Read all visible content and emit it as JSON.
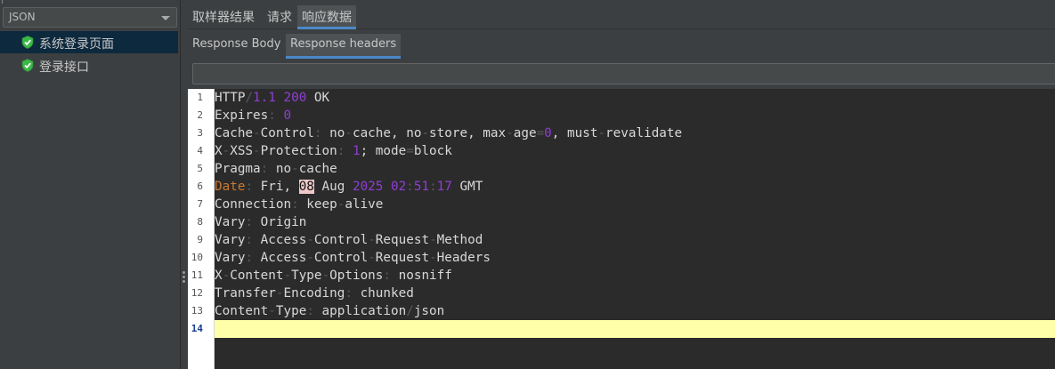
{
  "sidebar": {
    "combo_value": "JSON",
    "items": [
      {
        "label": "系统登录页面",
        "selected": true
      },
      {
        "label": "登录接口",
        "selected": false
      }
    ]
  },
  "tabs": [
    "取样器结果",
    "请求",
    "响应数据"
  ],
  "active_tab": "响应数据",
  "subtabs": [
    "Response Body",
    "Response headers"
  ],
  "active_subtab": "Response headers",
  "search": {
    "value": ""
  },
  "editor": {
    "current_line": 14,
    "lines": [
      {
        "n": "1",
        "segs": [
          [
            "k",
            "HTTP"
          ],
          [
            "p",
            "/"
          ],
          [
            "n",
            "1.1"
          ],
          [
            "p",
            " "
          ],
          [
            "n",
            "200"
          ],
          [
            "p",
            " "
          ],
          [
            "k",
            "OK"
          ]
        ]
      },
      {
        "n": "2",
        "segs": [
          [
            "k",
            "Expires"
          ],
          [
            "p",
            ": "
          ],
          [
            "n",
            "0"
          ]
        ]
      },
      {
        "n": "3",
        "segs": [
          [
            "k",
            "Cache"
          ],
          [
            "p",
            "-"
          ],
          [
            "k",
            "Control"
          ],
          [
            "p",
            ": "
          ],
          [
            "k",
            "no"
          ],
          [
            "p",
            "-"
          ],
          [
            "k",
            "cache, no"
          ],
          [
            "p",
            "-"
          ],
          [
            "k",
            "store, max"
          ],
          [
            "p",
            "-"
          ],
          [
            "k",
            "age"
          ],
          [
            "p",
            "="
          ],
          [
            "n",
            "0"
          ],
          [
            "k",
            ", must"
          ],
          [
            "p",
            "-"
          ],
          [
            "k",
            "revalidate"
          ]
        ]
      },
      {
        "n": "4",
        "segs": [
          [
            "k",
            "X"
          ],
          [
            "p",
            "-"
          ],
          [
            "k",
            "XSS"
          ],
          [
            "p",
            "-"
          ],
          [
            "k",
            "Protection"
          ],
          [
            "p",
            ": "
          ],
          [
            "n",
            "1"
          ],
          [
            "k",
            "; mode"
          ],
          [
            "p",
            "="
          ],
          [
            "k",
            "block"
          ]
        ]
      },
      {
        "n": "5",
        "segs": [
          [
            "k",
            "Pragma"
          ],
          [
            "p",
            ": "
          ],
          [
            "k",
            "no"
          ],
          [
            "p",
            "-"
          ],
          [
            "k",
            "cache"
          ]
        ]
      },
      {
        "n": "6",
        "segs": [
          [
            "o",
            "Date"
          ],
          [
            "p",
            ": "
          ],
          [
            "k",
            "Fri, "
          ],
          [
            "h",
            "08"
          ],
          [
            "p",
            " "
          ],
          [
            "k",
            "Aug"
          ],
          [
            "p",
            " "
          ],
          [
            "n",
            "2025"
          ],
          [
            "p",
            " "
          ],
          [
            "n",
            "02"
          ],
          [
            "p",
            ":"
          ],
          [
            "n",
            "51"
          ],
          [
            "p",
            ":"
          ],
          [
            "n",
            "17"
          ],
          [
            "p",
            " "
          ],
          [
            "k",
            "GMT"
          ]
        ]
      },
      {
        "n": "7",
        "segs": [
          [
            "k",
            "Connection"
          ],
          [
            "p",
            ": "
          ],
          [
            "k",
            "keep"
          ],
          [
            "p",
            "-"
          ],
          [
            "k",
            "alive"
          ]
        ]
      },
      {
        "n": "8",
        "segs": [
          [
            "k",
            "Vary"
          ],
          [
            "p",
            ": "
          ],
          [
            "k",
            "Origin"
          ]
        ]
      },
      {
        "n": "9",
        "segs": [
          [
            "k",
            "Vary"
          ],
          [
            "p",
            ": "
          ],
          [
            "k",
            "Access"
          ],
          [
            "p",
            "-"
          ],
          [
            "k",
            "Control"
          ],
          [
            "p",
            "-"
          ],
          [
            "k",
            "Request"
          ],
          [
            "p",
            "-"
          ],
          [
            "k",
            "Method"
          ]
        ]
      },
      {
        "n": "10",
        "segs": [
          [
            "k",
            "Vary"
          ],
          [
            "p",
            ": "
          ],
          [
            "k",
            "Access"
          ],
          [
            "p",
            "-"
          ],
          [
            "k",
            "Control"
          ],
          [
            "p",
            "-"
          ],
          [
            "k",
            "Request"
          ],
          [
            "p",
            "-"
          ],
          [
            "k",
            "Headers"
          ]
        ]
      },
      {
        "n": "11",
        "segs": [
          [
            "k",
            "X"
          ],
          [
            "p",
            "-"
          ],
          [
            "k",
            "Content"
          ],
          [
            "p",
            "-"
          ],
          [
            "k",
            "Type"
          ],
          [
            "p",
            "-"
          ],
          [
            "k",
            "Options"
          ],
          [
            "p",
            ": "
          ],
          [
            "k",
            "nosniff"
          ]
        ]
      },
      {
        "n": "12",
        "segs": [
          [
            "k",
            "Transfer"
          ],
          [
            "p",
            "-"
          ],
          [
            "k",
            "Encoding"
          ],
          [
            "p",
            ": "
          ],
          [
            "k",
            "chunked"
          ]
        ]
      },
      {
        "n": "13",
        "segs": [
          [
            "k",
            "Content"
          ],
          [
            "p",
            "-"
          ],
          [
            "k",
            "Type"
          ],
          [
            "p",
            ": "
          ],
          [
            "k",
            "application"
          ],
          [
            "p",
            "/"
          ],
          [
            "k",
            "json"
          ]
        ]
      },
      {
        "n": "14",
        "segs": []
      }
    ]
  }
}
